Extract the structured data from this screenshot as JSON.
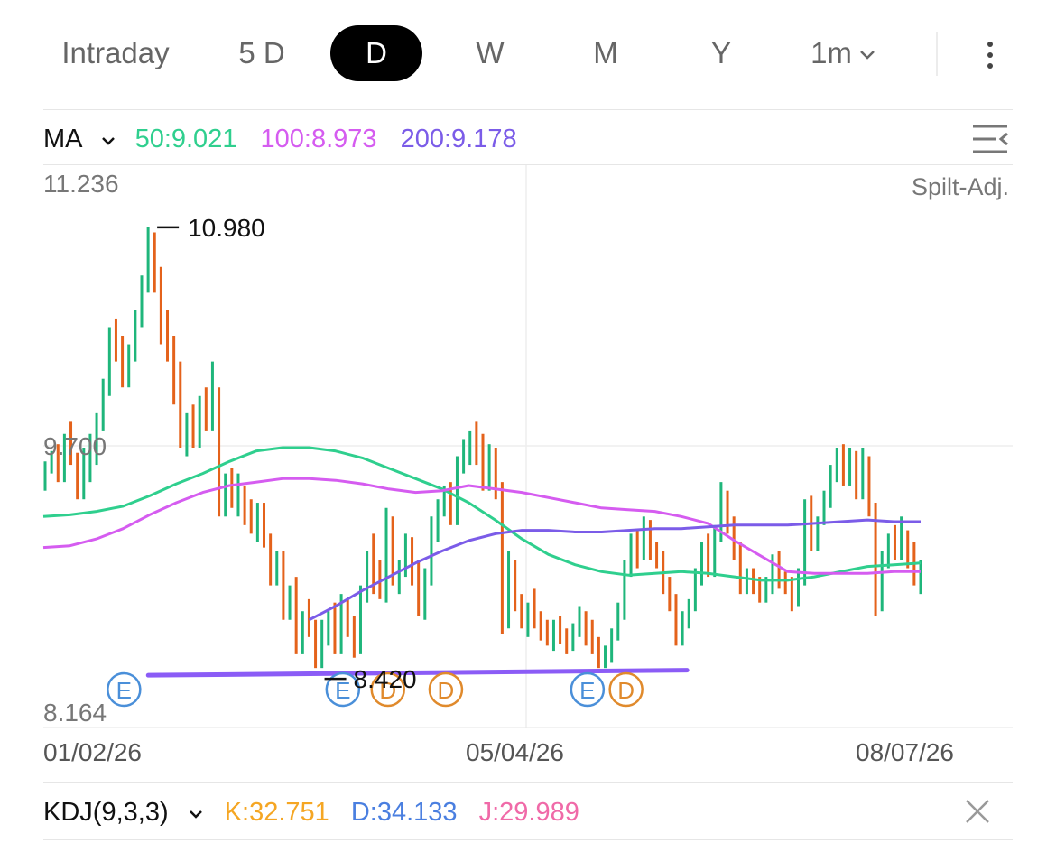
{
  "tabs": [
    {
      "label": "Intraday",
      "active": false
    },
    {
      "label": "5 D",
      "active": false
    },
    {
      "label": "D",
      "active": true
    },
    {
      "label": "W",
      "active": false
    },
    {
      "label": "M",
      "active": false
    },
    {
      "label": "Y",
      "active": false
    },
    {
      "label": "1m",
      "active": false,
      "dropdown": true
    }
  ],
  "ma": {
    "label": "MA",
    "ma50": "50:9.021",
    "ma100": "100:8.973",
    "ma200": "200:9.178"
  },
  "colors": {
    "up": "#1fb67b",
    "down": "#e4621b",
    "ma50": "#2fcf8e",
    "ma100": "#d55cf0",
    "ma200": "#7b5ce8",
    "trend": "#8b5cf6",
    "earnings": "#4a8fd9",
    "dividend": "#e08a2c",
    "k": "#f5a623",
    "d": "#4a7fe0",
    "j": "#f06aa8"
  },
  "icons": {
    "more": "more-vertical-icon",
    "settings": "indicator-list-icon",
    "close": "close-icon",
    "dropdown": "chevron-down-icon"
  },
  "chart_data": {
    "type": "ohlc",
    "split_label": "Spilt-Adj.",
    "y_ticks": [
      "11.236",
      "9.700",
      "8.164"
    ],
    "ylim": [
      8.164,
      11.236
    ],
    "x_labels": [
      "01/02/26",
      "05/04/26",
      "08/07/26"
    ],
    "high_label": "10.980",
    "low_label": "8.420",
    "high_value": 10.98,
    "low_value": 8.42,
    "bars": [
      {
        "o": 9.5,
        "h": 9.62,
        "l": 9.45,
        "c": 9.58
      },
      {
        "o": 9.58,
        "h": 9.68,
        "l": 9.55,
        "c": 9.65
      },
      {
        "o": 9.65,
        "h": 9.72,
        "l": 9.5,
        "c": 9.55
      },
      {
        "o": 9.55,
        "h": 9.78,
        "l": 9.5,
        "c": 9.75
      },
      {
        "o": 9.75,
        "h": 9.85,
        "l": 9.6,
        "c": 9.65
      },
      {
        "o": 9.65,
        "h": 9.67,
        "l": 9.4,
        "c": 9.45
      },
      {
        "o": 9.45,
        "h": 9.7,
        "l": 9.4,
        "c": 9.65
      },
      {
        "o": 9.65,
        "h": 9.78,
        "l": 9.5,
        "c": 9.72
      },
      {
        "o": 9.72,
        "h": 9.9,
        "l": 9.6,
        "c": 9.85
      },
      {
        "o": 9.85,
        "h": 10.1,
        "l": 9.8,
        "c": 10.05
      },
      {
        "o": 10.05,
        "h": 10.4,
        "l": 10.0,
        "c": 10.35
      },
      {
        "o": 10.35,
        "h": 10.45,
        "l": 10.2,
        "c": 10.25
      },
      {
        "o": 10.25,
        "h": 10.35,
        "l": 10.05,
        "c": 10.1
      },
      {
        "o": 10.1,
        "h": 10.3,
        "l": 10.05,
        "c": 10.25
      },
      {
        "o": 10.25,
        "h": 10.5,
        "l": 10.2,
        "c": 10.45
      },
      {
        "o": 10.45,
        "h": 10.7,
        "l": 10.4,
        "c": 10.65
      },
      {
        "o": 10.65,
        "h": 10.98,
        "l": 10.6,
        "c": 10.9
      },
      {
        "o": 10.9,
        "h": 10.95,
        "l": 10.6,
        "c": 10.7
      },
      {
        "o": 10.7,
        "h": 10.75,
        "l": 10.3,
        "c": 10.35
      },
      {
        "o": 10.35,
        "h": 10.5,
        "l": 10.2,
        "c": 10.3
      },
      {
        "o": 10.3,
        "h": 10.35,
        "l": 9.95,
        "c": 10.0
      },
      {
        "o": 10.0,
        "h": 10.2,
        "l": 9.7,
        "c": 9.75
      },
      {
        "o": 9.75,
        "h": 9.9,
        "l": 9.65,
        "c": 9.85
      },
      {
        "o": 9.85,
        "h": 9.95,
        "l": 9.7,
        "c": 9.75
      },
      {
        "o": 9.75,
        "h": 10.0,
        "l": 9.7,
        "c": 9.95
      },
      {
        "o": 9.95,
        "h": 10.05,
        "l": 9.8,
        "c": 9.85
      },
      {
        "o": 9.85,
        "h": 10.2,
        "l": 9.8,
        "c": 10.0
      },
      {
        "o": 10.0,
        "h": 10.05,
        "l": 9.3,
        "c": 9.35
      },
      {
        "o": 9.35,
        "h": 9.55,
        "l": 9.3,
        "c": 9.5
      },
      {
        "o": 9.5,
        "h": 9.58,
        "l": 9.35,
        "c": 9.4
      },
      {
        "o": 9.4,
        "h": 9.55,
        "l": 9.3,
        "c": 9.45
      },
      {
        "o": 9.45,
        "h": 9.48,
        "l": 9.25,
        "c": 9.3
      },
      {
        "o": 9.3,
        "h": 9.4,
        "l": 9.2,
        "c": 9.25
      },
      {
        "o": 9.25,
        "h": 9.38,
        "l": 9.15,
        "c": 9.35
      },
      {
        "o": 9.35,
        "h": 9.38,
        "l": 9.12,
        "c": 9.15
      },
      {
        "o": 9.15,
        "h": 9.2,
        "l": 8.9,
        "c": 8.95
      },
      {
        "o": 8.95,
        "h": 9.1,
        "l": 8.9,
        "c": 9.05
      },
      {
        "o": 9.05,
        "h": 9.1,
        "l": 8.7,
        "c": 8.75
      },
      {
        "o": 8.75,
        "h": 8.9,
        "l": 8.7,
        "c": 8.85
      },
      {
        "o": 8.85,
        "h": 8.95,
        "l": 8.5,
        "c": 8.55
      },
      {
        "o": 8.55,
        "h": 8.75,
        "l": 8.5,
        "c": 8.72
      },
      {
        "o": 8.72,
        "h": 8.82,
        "l": 8.6,
        "c": 8.65
      },
      {
        "o": 8.65,
        "h": 8.7,
        "l": 8.42,
        "c": 8.45
      },
      {
        "o": 8.45,
        "h": 8.7,
        "l": 8.42,
        "c": 8.65
      },
      {
        "o": 8.65,
        "h": 8.75,
        "l": 8.55,
        "c": 8.72
      },
      {
        "o": 8.72,
        "h": 8.8,
        "l": 8.5,
        "c": 8.55
      },
      {
        "o": 8.55,
        "h": 8.85,
        "l": 8.5,
        "c": 8.8
      },
      {
        "o": 8.8,
        "h": 8.82,
        "l": 8.6,
        "c": 8.65
      },
      {
        "o": 8.65,
        "h": 8.72,
        "l": 8.48,
        "c": 8.52
      },
      {
        "o": 8.52,
        "h": 8.9,
        "l": 8.5,
        "c": 8.85
      },
      {
        "o": 8.85,
        "h": 9.1,
        "l": 8.8,
        "c": 9.05
      },
      {
        "o": 9.05,
        "h": 9.2,
        "l": 8.85,
        "c": 8.9
      },
      {
        "o": 8.9,
        "h": 9.05,
        "l": 8.82,
        "c": 8.85
      },
      {
        "o": 8.85,
        "h": 9.35,
        "l": 8.8,
        "c": 9.25
      },
      {
        "o": 9.25,
        "h": 9.3,
        "l": 8.9,
        "c": 8.95
      },
      {
        "o": 8.95,
        "h": 9.05,
        "l": 8.85,
        "c": 9.0
      },
      {
        "o": 9.0,
        "h": 9.2,
        "l": 8.95,
        "c": 9.15
      },
      {
        "o": 9.15,
        "h": 9.18,
        "l": 8.9,
        "c": 8.95
      },
      {
        "o": 8.95,
        "h": 9.05,
        "l": 8.72,
        "c": 8.78
      },
      {
        "o": 8.78,
        "h": 9.0,
        "l": 8.7,
        "c": 8.95
      },
      {
        "o": 8.95,
        "h": 9.3,
        "l": 8.9,
        "c": 9.25
      },
      {
        "o": 9.25,
        "h": 9.4,
        "l": 9.15,
        "c": 9.35
      },
      {
        "o": 9.35,
        "h": 9.48,
        "l": 9.3,
        "c": 9.45
      },
      {
        "o": 9.45,
        "h": 9.5,
        "l": 9.25,
        "c": 9.3
      },
      {
        "o": 9.3,
        "h": 9.65,
        "l": 9.25,
        "c": 9.6
      },
      {
        "o": 9.6,
        "h": 9.75,
        "l": 9.55,
        "c": 9.7
      },
      {
        "o": 9.7,
        "h": 9.8,
        "l": 9.6,
        "c": 9.75
      },
      {
        "o": 9.75,
        "h": 9.85,
        "l": 9.6,
        "c": 9.65
      },
      {
        "o": 9.65,
        "h": 9.78,
        "l": 9.45,
        "c": 9.5
      },
      {
        "o": 9.5,
        "h": 9.72,
        "l": 9.45,
        "c": 9.68
      },
      {
        "o": 9.68,
        "h": 9.7,
        "l": 9.4,
        "c": 9.45
      },
      {
        "o": 9.45,
        "h": 9.5,
        "l": 8.62,
        "c": 8.7
      },
      {
        "o": 8.7,
        "h": 9.1,
        "l": 8.65,
        "c": 9.0
      },
      {
        "o": 9.0,
        "h": 9.05,
        "l": 8.75,
        "c": 8.8
      },
      {
        "o": 8.8,
        "h": 8.85,
        "l": 8.65,
        "c": 8.7
      },
      {
        "o": 8.7,
        "h": 8.8,
        "l": 8.6,
        "c": 8.75
      },
      {
        "o": 8.75,
        "h": 8.88,
        "l": 8.65,
        "c": 8.7
      },
      {
        "o": 8.7,
        "h": 8.75,
        "l": 8.58,
        "c": 8.62
      },
      {
        "o": 8.62,
        "h": 8.7,
        "l": 8.55,
        "c": 8.6
      },
      {
        "o": 8.6,
        "h": 8.7,
        "l": 8.52,
        "c": 8.65
      },
      {
        "o": 8.65,
        "h": 8.72,
        "l": 8.56,
        "c": 8.6
      },
      {
        "o": 8.6,
        "h": 8.65,
        "l": 8.5,
        "c": 8.55
      },
      {
        "o": 8.55,
        "h": 8.68,
        "l": 8.52,
        "c": 8.65
      },
      {
        "o": 8.65,
        "h": 8.78,
        "l": 8.6,
        "c": 8.7
      },
      {
        "o": 8.7,
        "h": 8.75,
        "l": 8.55,
        "c": 8.6
      },
      {
        "o": 8.6,
        "h": 8.7,
        "l": 8.5,
        "c": 8.55
      },
      {
        "o": 8.55,
        "h": 8.6,
        "l": 8.42,
        "c": 8.45
      },
      {
        "o": 8.45,
        "h": 8.55,
        "l": 8.42,
        "c": 8.52
      },
      {
        "o": 8.52,
        "h": 8.65,
        "l": 8.45,
        "c": 8.62
      },
      {
        "o": 8.62,
        "h": 8.8,
        "l": 8.58,
        "c": 8.75
      },
      {
        "o": 8.75,
        "h": 9.05,
        "l": 8.7,
        "c": 9.0
      },
      {
        "o": 9.0,
        "h": 9.2,
        "l": 8.95,
        "c": 9.15
      },
      {
        "o": 9.15,
        "h": 9.22,
        "l": 9.0,
        "c": 9.08
      },
      {
        "o": 9.08,
        "h": 9.3,
        "l": 9.05,
        "c": 9.25
      },
      {
        "o": 9.25,
        "h": 9.28,
        "l": 9.05,
        "c": 9.1
      },
      {
        "o": 9.1,
        "h": 9.15,
        "l": 9.0,
        "c": 9.05
      },
      {
        "o": 9.05,
        "h": 9.1,
        "l": 8.85,
        "c": 8.9
      },
      {
        "o": 8.9,
        "h": 8.95,
        "l": 8.75,
        "c": 8.8
      },
      {
        "o": 8.8,
        "h": 8.85,
        "l": 8.55,
        "c": 8.6
      },
      {
        "o": 8.6,
        "h": 8.75,
        "l": 8.55,
        "c": 8.72
      },
      {
        "o": 8.72,
        "h": 8.82,
        "l": 8.65,
        "c": 8.78
      },
      {
        "o": 8.78,
        "h": 9.0,
        "l": 8.75,
        "c": 8.95
      },
      {
        "o": 8.95,
        "h": 9.15,
        "l": 8.9,
        "c": 9.1
      },
      {
        "o": 9.1,
        "h": 9.2,
        "l": 8.95,
        "c": 9.0
      },
      {
        "o": 9.0,
        "h": 9.25,
        "l": 8.95,
        "c": 9.2
      },
      {
        "o": 9.2,
        "h": 9.5,
        "l": 9.15,
        "c": 9.4
      },
      {
        "o": 9.4,
        "h": 9.45,
        "l": 9.2,
        "c": 9.25
      },
      {
        "o": 9.25,
        "h": 9.3,
        "l": 9.05,
        "c": 9.1
      },
      {
        "o": 9.1,
        "h": 9.15,
        "l": 8.85,
        "c": 8.9
      },
      {
        "o": 8.9,
        "h": 9.0,
        "l": 8.85,
        "c": 8.95
      },
      {
        "o": 8.95,
        "h": 9.0,
        "l": 8.85,
        "c": 8.9
      },
      {
        "o": 8.9,
        "h": 8.95,
        "l": 8.8,
        "c": 8.85
      },
      {
        "o": 8.85,
        "h": 8.95,
        "l": 8.8,
        "c": 8.9
      },
      {
        "o": 8.9,
        "h": 9.08,
        "l": 8.85,
        "c": 9.05
      },
      {
        "o": 9.05,
        "h": 9.1,
        "l": 8.88,
        "c": 8.92
      },
      {
        "o": 8.92,
        "h": 8.98,
        "l": 8.85,
        "c": 8.9
      },
      {
        "o": 8.9,
        "h": 8.95,
        "l": 8.75,
        "c": 8.8
      },
      {
        "o": 8.8,
        "h": 9.0,
        "l": 8.78,
        "c": 8.95
      },
      {
        "o": 8.95,
        "h": 9.4,
        "l": 8.9,
        "c": 9.35
      },
      {
        "o": 9.35,
        "h": 9.42,
        "l": 9.1,
        "c": 9.15
      },
      {
        "o": 9.15,
        "h": 9.3,
        "l": 9.1,
        "c": 9.28
      },
      {
        "o": 9.28,
        "h": 9.45,
        "l": 9.25,
        "c": 9.4
      },
      {
        "o": 9.4,
        "h": 9.6,
        "l": 9.35,
        "c": 9.55
      },
      {
        "o": 9.55,
        "h": 9.7,
        "l": 9.5,
        "c": 9.65
      },
      {
        "o": 9.65,
        "h": 9.72,
        "l": 9.48,
        "c": 9.52
      },
      {
        "o": 9.52,
        "h": 9.7,
        "l": 9.48,
        "c": 9.65
      },
      {
        "o": 9.65,
        "h": 9.68,
        "l": 9.4,
        "c": 9.45
      },
      {
        "o": 9.45,
        "h": 9.7,
        "l": 9.4,
        "c": 9.62
      },
      {
        "o": 9.62,
        "h": 9.65,
        "l": 9.3,
        "c": 9.35
      },
      {
        "o": 9.35,
        "h": 9.38,
        "l": 8.72,
        "c": 8.8
      },
      {
        "o": 8.8,
        "h": 9.1,
        "l": 8.75,
        "c": 9.05
      },
      {
        "o": 9.05,
        "h": 9.2,
        "l": 9.0,
        "c": 9.15
      },
      {
        "o": 9.15,
        "h": 9.25,
        "l": 9.05,
        "c": 9.1
      },
      {
        "o": 9.1,
        "h": 9.3,
        "l": 9.05,
        "c": 9.2
      },
      {
        "o": 9.2,
        "h": 9.22,
        "l": 9.0,
        "c": 9.05
      },
      {
        "o": 9.05,
        "h": 9.15,
        "l": 8.9,
        "c": 8.95
      },
      {
        "o": 8.95,
        "h": 9.05,
        "l": 8.85,
        "c": 9.0
      }
    ],
    "series": [
      {
        "name": "50",
        "values": [
          9.3,
          9.31,
          9.33,
          9.36,
          9.42,
          9.49,
          9.55,
          9.62,
          9.68,
          9.7,
          9.7,
          9.68,
          9.64,
          9.58,
          9.52,
          9.46,
          9.38,
          9.28,
          9.17,
          9.08,
          9.02,
          8.98,
          8.96,
          8.97,
          8.98,
          8.97,
          8.95,
          8.93,
          8.93,
          8.95,
          8.98,
          9.01,
          9.02,
          9.03
        ]
      },
      {
        "name": "100",
        "values": [
          9.12,
          9.13,
          9.17,
          9.23,
          9.31,
          9.38,
          9.44,
          9.48,
          9.5,
          9.52,
          9.52,
          9.51,
          9.49,
          9.46,
          9.44,
          9.45,
          9.48,
          9.46,
          9.44,
          9.41,
          9.38,
          9.35,
          9.34,
          9.33,
          9.3,
          9.26,
          9.16,
          9.07,
          8.98,
          8.97,
          8.97,
          8.97,
          8.98,
          8.98
        ]
      },
      {
        "name": "200",
        "values": [
          null,
          null,
          null,
          null,
          null,
          null,
          null,
          null,
          null,
          null,
          8.7,
          8.78,
          8.87,
          8.95,
          9.03,
          9.1,
          9.16,
          9.2,
          9.22,
          9.22,
          9.21,
          9.21,
          9.22,
          9.23,
          9.23,
          9.24,
          9.25,
          9.25,
          9.25,
          9.26,
          9.27,
          9.28,
          9.27,
          9.27
        ]
      }
    ],
    "trendlines": [
      {
        "from": [
          2,
          8.42
        ],
        "to": [
          92,
          8.47
        ]
      }
    ],
    "events": [
      {
        "type": "E",
        "index": 10
      },
      {
        "type": "E",
        "index": 44
      },
      {
        "type": "D",
        "index": 51
      },
      {
        "type": "D",
        "index": 60
      },
      {
        "type": "E",
        "index": 82
      },
      {
        "type": "D",
        "index": 88
      }
    ]
  },
  "kdj": {
    "label": "KDJ(9,3,3)",
    "k": "K:32.751",
    "d": "D:34.133",
    "j": "J:29.989"
  }
}
